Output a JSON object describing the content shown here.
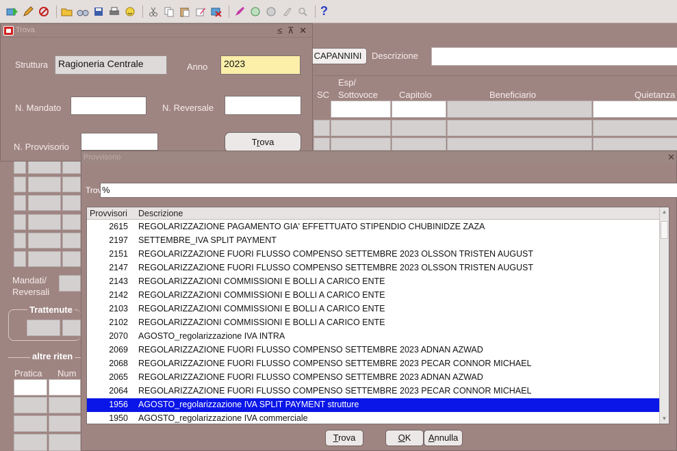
{
  "toolbar": {
    "icons": [
      "new-record-icon",
      "pencil-icon",
      "no-entry-icon",
      "folder-open-icon",
      "binoculars-icon",
      "save-icon",
      "print-icon",
      "smiley-icon",
      "cut-icon",
      "copy-icon",
      "paste-icon",
      "edit-icon",
      "delete-record-icon",
      "clear-icon",
      "translate-icon",
      "globe-icon",
      "attach-icon",
      "zoom-icon",
      "help-icon"
    ],
    "help_glyph": "?"
  },
  "background_form": {
    "cognome_value": "CAPANNINI",
    "descrizione_label": "Descrizione",
    "columns": {
      "sc": "SC",
      "esp": "Esp/\nSottovoce",
      "capitolo": "Capitolo",
      "beneficiario": "Beneficiario",
      "quietanza": "Quietanza"
    },
    "mandati_label_1": "Mandati/",
    "mandati_label_2": "Reversali",
    "trattenute_label": "Trattenute",
    "altre_label": "altre riten",
    "pratica_label": "Pratica",
    "num_label": "Num"
  },
  "trova_window": {
    "title": "Trova",
    "controls": "≤ ⊼ ✕",
    "struttura_label": "Struttura",
    "struttura_value": "Ragioneria Centrale",
    "anno_label": "Anno",
    "anno_value": "2023",
    "n_mandato_label": "N. Mandato",
    "n_mandato_value": "",
    "n_reversale_label": "N. Reversale",
    "n_reversale_value": "",
    "n_provvisorio_label": "N. Provvisorio",
    "n_provvisorio_value": "",
    "trova_button": {
      "before": "T",
      "accel": "r",
      "after": "ova"
    }
  },
  "provvisorio_window": {
    "title": "Provvisorio",
    "close": "✕",
    "trova_label": "Trova",
    "trova_value": "%",
    "col_provvisori": "Provvisori",
    "col_descrizione": "Descrizione",
    "rows": [
      {
        "num": "2615",
        "desc": "REGOLARIZZAZIONE PAGAMENTO GIA' EFFETTUATO STIPENDIO CHUBINIDZE ZAZA"
      },
      {
        "num": "2197",
        "desc": "SETTEMBRE_IVA SPLIT PAYMENT"
      },
      {
        "num": "2151",
        "desc": "REGOLARIZZAZIONE FUORI FLUSSO  COMPENSO SETTEMBRE 2023 OLSSON TRISTEN AUGUST"
      },
      {
        "num": "2147",
        "desc": "REGOLARIZZAZIONE FUORI FLUSSO  COMPENSO SETTEMBRE 2023 OLSSON TRISTEN AUGUST"
      },
      {
        "num": "2143",
        "desc": "REGOLARIZZAZIONI COMMISSIONI E BOLLI A CARICO ENTE"
      },
      {
        "num": "2142",
        "desc": "REGOLARIZZAZIONI COMMISSIONI E BOLLI A CARICO ENTE"
      },
      {
        "num": "2103",
        "desc": "REGOLARIZZAZIONI COMMISSIONI E BOLLI A CARICO ENTE"
      },
      {
        "num": "2102",
        "desc": "REGOLARIZZAZIONI COMMISSIONI E BOLLI A CARICO ENTE"
      },
      {
        "num": "2070",
        "desc": "AGOSTO_regolarizzazione IVA INTRA"
      },
      {
        "num": "2069",
        "desc": "REGOLARIZZAZIONE FUORI FLUSSO  COMPENSO SETTEMBRE 2023 ADNAN AZWAD"
      },
      {
        "num": "2068",
        "desc": "REGOLARIZZAZIONE FUORI FLUSSO COMPENSO SETTEMBRE 2023 PECAR CONNOR MICHAEL"
      },
      {
        "num": "2065",
        "desc": "REGOLARIZZAZIONE FUORI FLUSSO  COMPENSO SETTEMBRE 2023 ADNAN AZWAD"
      },
      {
        "num": "2064",
        "desc": "REGOLARIZZAZIONE FUORI FLUSSO COMPENSO SETTEMBRE 2023 PECAR CONNOR MICHAEL"
      },
      {
        "num": "1956",
        "desc": "AGOSTO_regolarizzazione IVA SPLIT PAYMENT strutture"
      },
      {
        "num": "1950",
        "desc": "AGOSTO_regolarizzazione IVA commerciale"
      }
    ],
    "selected_num": "1956",
    "buttons": {
      "trova": {
        "accel": "T",
        "after": "rova"
      },
      "ok": {
        "accel": "O",
        "after": "K"
      },
      "annulla": {
        "accel": "A",
        "after": "nnulla"
      }
    }
  },
  "colors": {
    "window_bg": "#9f8582",
    "selected_row": "#0a15e8",
    "anno_field": "#fcefa9"
  }
}
